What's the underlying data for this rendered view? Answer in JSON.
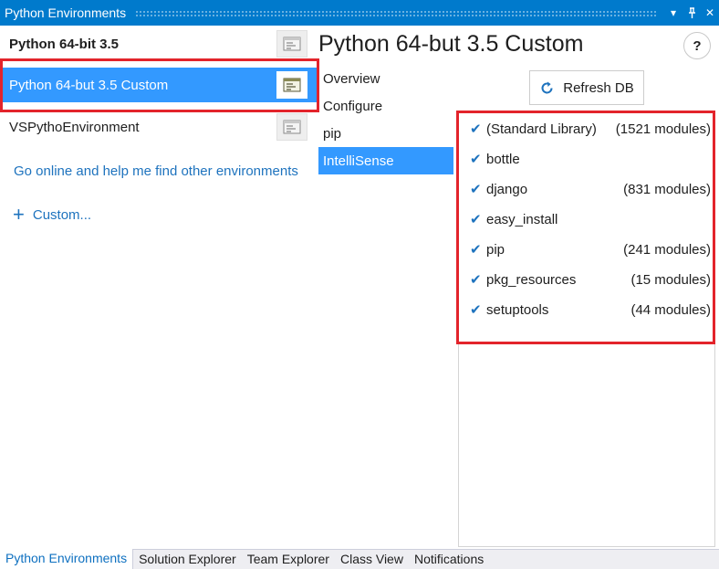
{
  "window": {
    "title": "Python Environments",
    "dropdown_glyph": "▾",
    "pin_glyph": "⊥",
    "close_glyph": "✕"
  },
  "environments": [
    {
      "label": "Python 64-bit 3.5",
      "is_default": true,
      "selected": false
    },
    {
      "label": "Python 64-but 3.5 Custom",
      "is_default": false,
      "selected": true
    },
    {
      "label": "VSPythoEnvironment",
      "is_default": false,
      "selected": false
    }
  ],
  "links": {
    "find_online": "Go online and help me find other environments",
    "custom": "Custom..."
  },
  "detail": {
    "title": "Python 64-but 3.5 Custom",
    "help_label": "?",
    "nav": [
      {
        "label": "Overview",
        "active": false
      },
      {
        "label": "Configure",
        "active": false
      },
      {
        "label": "pip",
        "active": false
      },
      {
        "label": "IntelliSense",
        "active": true
      }
    ],
    "refresh_label": "Refresh DB"
  },
  "modules": [
    {
      "name": "(Standard Library)",
      "count": "(1521 modules)",
      "checked": true
    },
    {
      "name": "bottle",
      "count": "",
      "checked": true
    },
    {
      "name": "django",
      "count": "(831 modules)",
      "checked": true
    },
    {
      "name": "easy_install",
      "count": "",
      "checked": true
    },
    {
      "name": "pip",
      "count": "(241 modules)",
      "checked": true
    },
    {
      "name": "pkg_resources",
      "count": "(15 modules)",
      "checked": true
    },
    {
      "name": "setuptools",
      "count": "(44 modules)",
      "checked": true
    }
  ],
  "check_glyph": "✔",
  "bottom_tabs": [
    {
      "label": "Python Environments",
      "active": true
    },
    {
      "label": "Solution Explorer",
      "active": false
    },
    {
      "label": "Team Explorer",
      "active": false
    },
    {
      "label": "Class View",
      "active": false
    },
    {
      "label": "Notifications",
      "active": false
    }
  ],
  "colors": {
    "accent": "#007acc",
    "selection": "#3399ff",
    "highlight_box": "#e3242b",
    "link": "#1e73be"
  }
}
